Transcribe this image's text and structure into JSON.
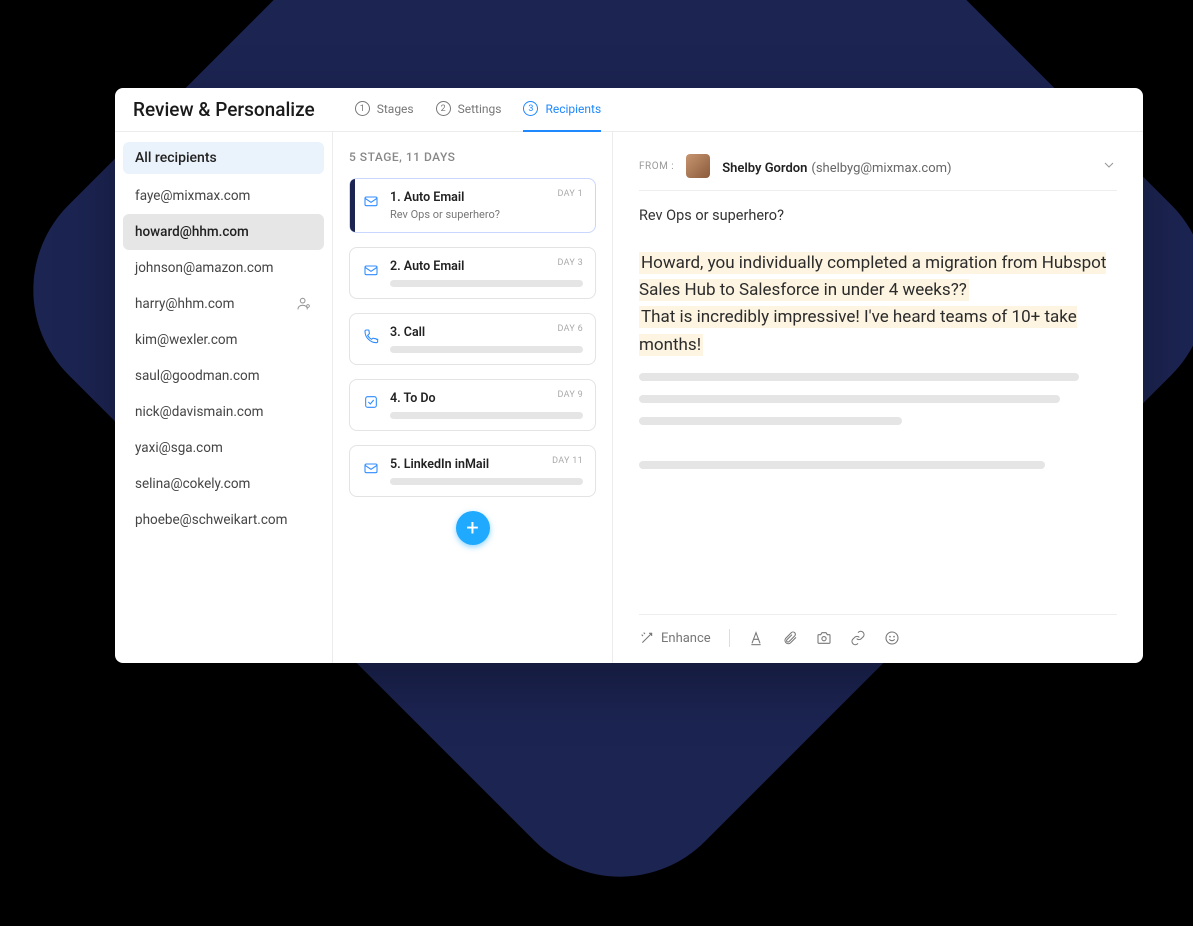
{
  "title": "Review & Personalize",
  "tabs": [
    {
      "num": "1",
      "label": "Stages",
      "active": false
    },
    {
      "num": "2",
      "label": "Settings",
      "active": false
    },
    {
      "num": "3",
      "label": "Recipients",
      "active": true
    }
  ],
  "recipients": {
    "header": "All recipients",
    "items": [
      {
        "email": "faye@mixmax.com",
        "selected": false,
        "member_icon": false
      },
      {
        "email": "howard@hhm.com",
        "selected": true,
        "member_icon": false
      },
      {
        "email": "johnson@amazon.com",
        "selected": false,
        "member_icon": false
      },
      {
        "email": "harry@hhm.com",
        "selected": false,
        "member_icon": true
      },
      {
        "email": "kim@wexler.com",
        "selected": false,
        "member_icon": false
      },
      {
        "email": "saul@goodman.com",
        "selected": false,
        "member_icon": false
      },
      {
        "email": "nick@davismain.com",
        "selected": false,
        "member_icon": false
      },
      {
        "email": "yaxi@sga.com",
        "selected": false,
        "member_icon": false
      },
      {
        "email": "selina@cokely.com",
        "selected": false,
        "member_icon": false
      },
      {
        "email": "phoebe@schweikart.com",
        "selected": false,
        "member_icon": false
      }
    ]
  },
  "stages": {
    "header": "5 STAGE, 11 DAYS",
    "items": [
      {
        "num": "1.",
        "title": "Auto Email",
        "subtitle": "Rev Ops or superhero?",
        "day": "DAY 1",
        "icon": "mail",
        "active": true
      },
      {
        "num": "2.",
        "title": "Auto Email",
        "subtitle": "",
        "day": "DAY 3",
        "icon": "mail",
        "active": false
      },
      {
        "num": "3.",
        "title": "Call",
        "subtitle": "",
        "day": "DAY 6",
        "icon": "phone",
        "active": false
      },
      {
        "num": "4.",
        "title": "To Do",
        "subtitle": "",
        "day": "DAY 9",
        "icon": "check",
        "active": false
      },
      {
        "num": "5.",
        "title": "LinkedIn inMail",
        "subtitle": "",
        "day": "DAY 11",
        "icon": "mail",
        "active": false
      }
    ],
    "add": "+"
  },
  "editor": {
    "from_label": "FROM :",
    "from_name": "Shelby Gordon",
    "from_email": "(shelbyg@mixmax.com)",
    "subject": "Rev Ops or superhero?",
    "body_line1": "Howard, you individually completed a migration from Hubspot Sales Hub to Salesforce in under 4 weeks??",
    "body_line2": "That is incredibly impressive! I've heard teams of 10+ take months!",
    "toolbar": {
      "enhance": "Enhance"
    }
  }
}
